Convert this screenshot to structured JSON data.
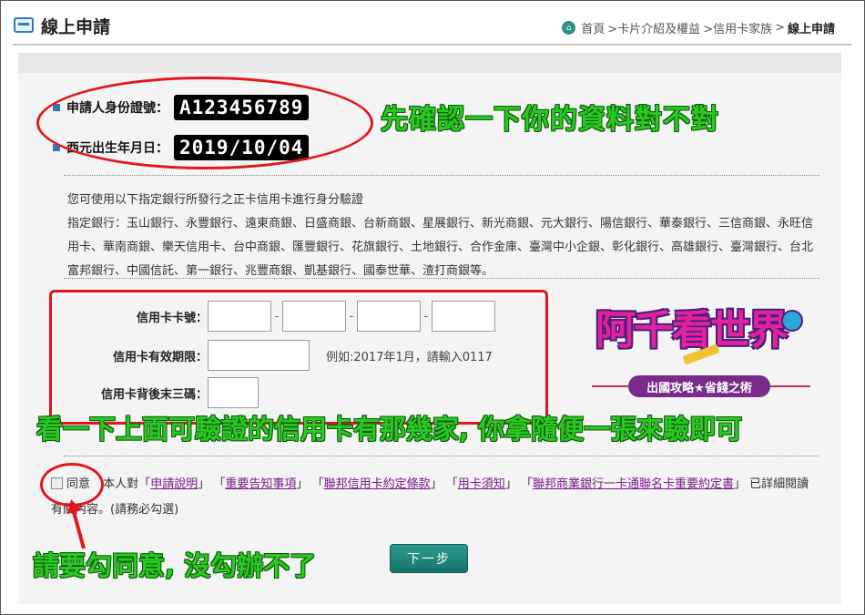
{
  "header": {
    "title": "線上申請",
    "breadcrumb": {
      "home": "首頁",
      "items": [
        ">卡片介紹及權益",
        ">信用卡家族",
        ">"
      ],
      "current": "線上申請"
    }
  },
  "applicant": {
    "id_label": "申請人身份證號：",
    "id_value": "A123456789",
    "birth_label": "西元出生年月日：",
    "birth_value": "2019/10/04"
  },
  "annotations": {
    "top": "先確認一下你的資料對不對",
    "middle": "看一下上面可驗證的信用卡有那幾家, 你拿隨便一張來驗即可",
    "bottom": "請要勾同意, 沒勾辦不了"
  },
  "banks": {
    "intro": "您可使用以下指定銀行所發行之正卡信用卡進行身分驗證",
    "list": "指定銀行：玉山銀行、永豐銀行、遠東商銀、日盛商銀、台新商銀、星展銀行、新光商銀、元大銀行、陽信銀行、華泰銀行、三信商銀、永旺信用卡、華南商銀、樂天信用卡、台中商銀、匯豐銀行、花旗銀行、土地銀行、合作金庫、臺灣中小企銀、彰化銀行、高雄銀行、臺灣銀行、台北富邦銀行、中國信託、第一銀行、兆豐商銀、凱基銀行、國泰世華、渣打商銀等。"
  },
  "form": {
    "card_number_label": "信用卡卡號：",
    "expiry_label": "信用卡有效期限：",
    "expiry_hint": "例如:2017年1月，請輸入0117",
    "cvv_label": "信用卡背後末三碼：",
    "dash": "-"
  },
  "logo": {
    "title": "阿千看世界",
    "subtitle": "出國攻略★省錢之術"
  },
  "agreement": {
    "checkbox_label": "同意",
    "prefix": "本人對",
    "open": "「",
    "close": "」",
    "links": [
      "申請說明",
      "重要告知事項",
      "聯邦信用卡約定條款",
      "用卡須知",
      "聯邦商業銀行一卡通聯名卡重要約定書"
    ],
    "suffix": "已詳細閱讀有關內容。(請務必勾選)"
  },
  "next_button": "下一步"
}
